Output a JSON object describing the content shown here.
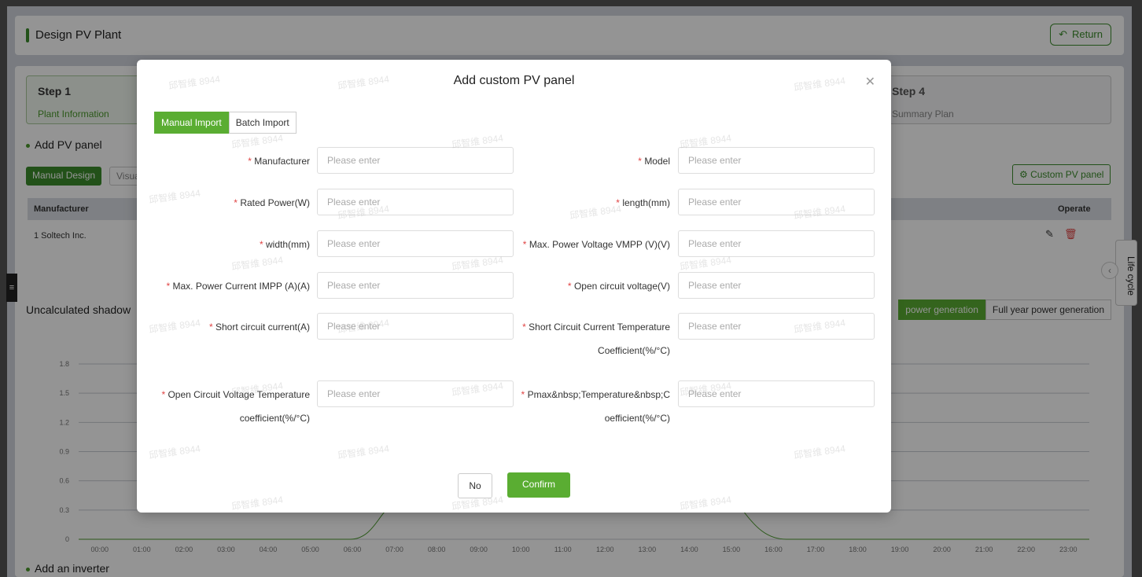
{
  "header": {
    "title": "Design PV Plant",
    "return_label": "Return"
  },
  "steps": [
    {
      "title": "Step 1",
      "subtitle": "Plant Information"
    },
    {
      "title": "Step 4",
      "subtitle": "Summary Plan"
    }
  ],
  "panel_section": {
    "title": "Add PV panel",
    "manual_design": "Manual Design",
    "visual_design": "Visua",
    "custom_button": "Custom PV panel",
    "columns": {
      "manufacturer": "Manufacturer",
      "operate": "Operate"
    },
    "rows": [
      {
        "manufacturer": "1 Soltech Inc."
      }
    ]
  },
  "shadow_section": {
    "title": "Uncalculated shadow",
    "tab_day": "power generation",
    "tab_year": "Full year power generation"
  },
  "inverter_section": {
    "title": "Add an inverter"
  },
  "life_cycle": "Life cycle",
  "chart_data": {
    "type": "line",
    "y_ticks": [
      "1.8",
      "1.5",
      "1.2",
      "0.9",
      "0.6",
      "0.3",
      "0"
    ],
    "x": [
      "00:00",
      "01:00",
      "02:00",
      "03:00",
      "04:00",
      "05:00",
      "06:00",
      "07:00",
      "08:00",
      "09:00",
      "10:00",
      "11:00",
      "12:00",
      "13:00",
      "14:00",
      "15:00",
      "16:00",
      "17:00",
      "18:00",
      "19:00",
      "20:00",
      "21:00",
      "22:00",
      "23:00"
    ],
    "ylim": [
      0,
      1.8
    ]
  },
  "modal": {
    "title": "Add custom PV panel",
    "tab_manual": "Manual Import",
    "tab_batch": "Batch Import",
    "placeholder": "Please enter",
    "watermark": "邱智维 8944",
    "fields": [
      {
        "label": "Manufacturer"
      },
      {
        "label": "Model"
      },
      {
        "label": "Rated Power(W)"
      },
      {
        "label": "length(mm)"
      },
      {
        "label": "width(mm)"
      },
      {
        "label": "Max. Power Voltage VMPP (V)(V)"
      },
      {
        "label": "Max. Power Current IMPP (A)(A)"
      },
      {
        "label": "Open circuit voltage(V)"
      },
      {
        "label": "Short circuit current(A)"
      },
      {
        "label": "Short Circuit Current Temperature",
        "label2": "Coefficient(%/°C)"
      },
      {
        "label": "Open Circuit Voltage Temperature",
        "label2": "coefficient(%/°C)"
      },
      {
        "label": "Pmax&nbsp;Temperature&nbsp;C",
        "label2": "oefficient(%/°C)"
      }
    ],
    "no_label": "No",
    "confirm_label": "Confirm"
  },
  "colors": {
    "accent": "#5aad32",
    "required": "#e04444"
  }
}
